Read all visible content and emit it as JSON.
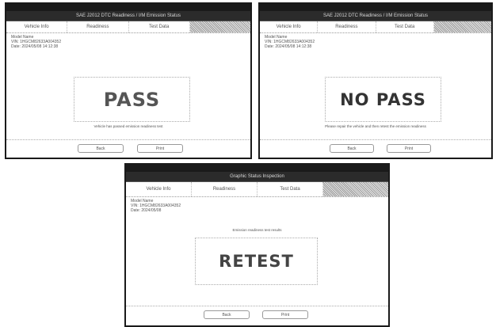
{
  "panels": [
    {
      "status_left": "",
      "status_right": "",
      "title": "SAE J2012 DTC Readiness / I/M Emission Status",
      "tabs": [
        "Vehicle Info",
        "Readiness",
        "Test Data",
        ""
      ],
      "info_lines": [
        "Model Name",
        "VIN: 1HGCM82633A004352",
        "Date: 2024/05/08 14:12:38"
      ],
      "result": "PASS",
      "caption": "Vehicle has passed emission readiness test",
      "buttons": [
        "Back",
        "Print"
      ]
    },
    {
      "status_left": "",
      "status_right": "",
      "title": "SAE J2012 DTC Readiness / I/M Emission Status",
      "tabs": [
        "Vehicle Info",
        "Readiness",
        "Test Data",
        ""
      ],
      "info_lines": [
        "Model Name",
        "VIN: 1HGCM82633A004352",
        "Date: 2024/05/08 14:12:38"
      ],
      "result": "NO PASS",
      "caption": "Please repair the vehicle and then retest the emission readiness",
      "buttons": [
        "Back",
        "Print"
      ]
    },
    {
      "status_left": "",
      "status_right": "",
      "title": "Graphic Status Inspection",
      "tabs": [
        "Vehicle Info",
        "Readiness",
        "Test Data",
        ""
      ],
      "info_lines": [
        "Model Name",
        "VIN: 1HGCM82633A004352",
        "Date: 2024/05/08"
      ],
      "subheader": "Emission readiness test results",
      "result": "RETEST",
      "caption": "",
      "buttons": [
        "Back",
        "Print"
      ]
    }
  ]
}
